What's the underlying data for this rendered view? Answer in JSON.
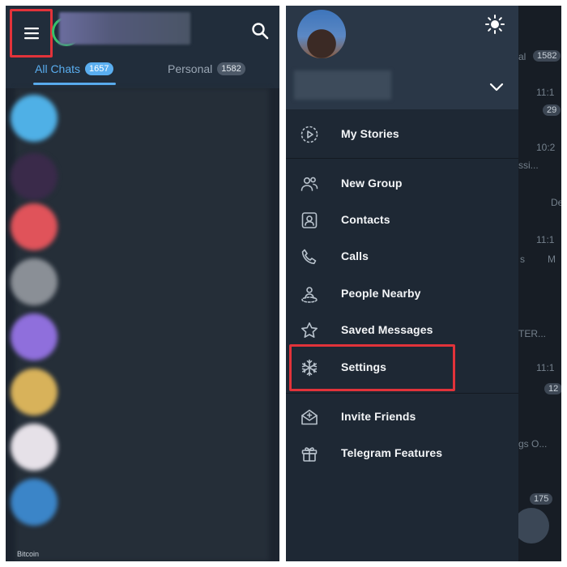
{
  "left_panel": {
    "tabs": [
      {
        "label": "All Chats",
        "count": "1657"
      },
      {
        "label": "Personal",
        "count": "1582"
      }
    ],
    "bottom_label": "Bitcoin"
  },
  "drawer": {
    "menu": [
      {
        "label": "My Stories",
        "icon": "stories-icon"
      },
      {
        "label": "New Group",
        "icon": "new-group-icon"
      },
      {
        "label": "Contacts",
        "icon": "contacts-icon"
      },
      {
        "label": "Calls",
        "icon": "calls-icon"
      },
      {
        "label": "People Nearby",
        "icon": "people-nearby-icon"
      },
      {
        "label": "Saved Messages",
        "icon": "saved-messages-icon"
      },
      {
        "label": "Settings",
        "icon": "settings-icon"
      },
      {
        "label": "Invite Friends",
        "icon": "invite-friends-icon"
      },
      {
        "label": "Telegram Features",
        "icon": "telegram-features-icon"
      }
    ]
  },
  "background_chats": {
    "items": [
      {
        "text": "al",
        "badge": "1582"
      },
      {
        "text": "11:1",
        "badge": "29"
      },
      {
        "text": "10:2"
      },
      {
        "text": "ssi...",
        "badge": ""
      },
      {
        "text": "De"
      },
      {
        "text": "11:1"
      },
      {
        "text": "s"
      },
      {
        "text": "M"
      },
      {
        "text": "TER..."
      },
      {
        "text": "11:1"
      },
      {
        "text": "12"
      },
      {
        "text": "gs O..."
      },
      {
        "text": "175"
      }
    ]
  },
  "colors": {
    "accent": "#5aaef0",
    "highlight_border": "#e2333a",
    "drawer_bg": "#1e2834",
    "header_bg": "#2a3747"
  }
}
